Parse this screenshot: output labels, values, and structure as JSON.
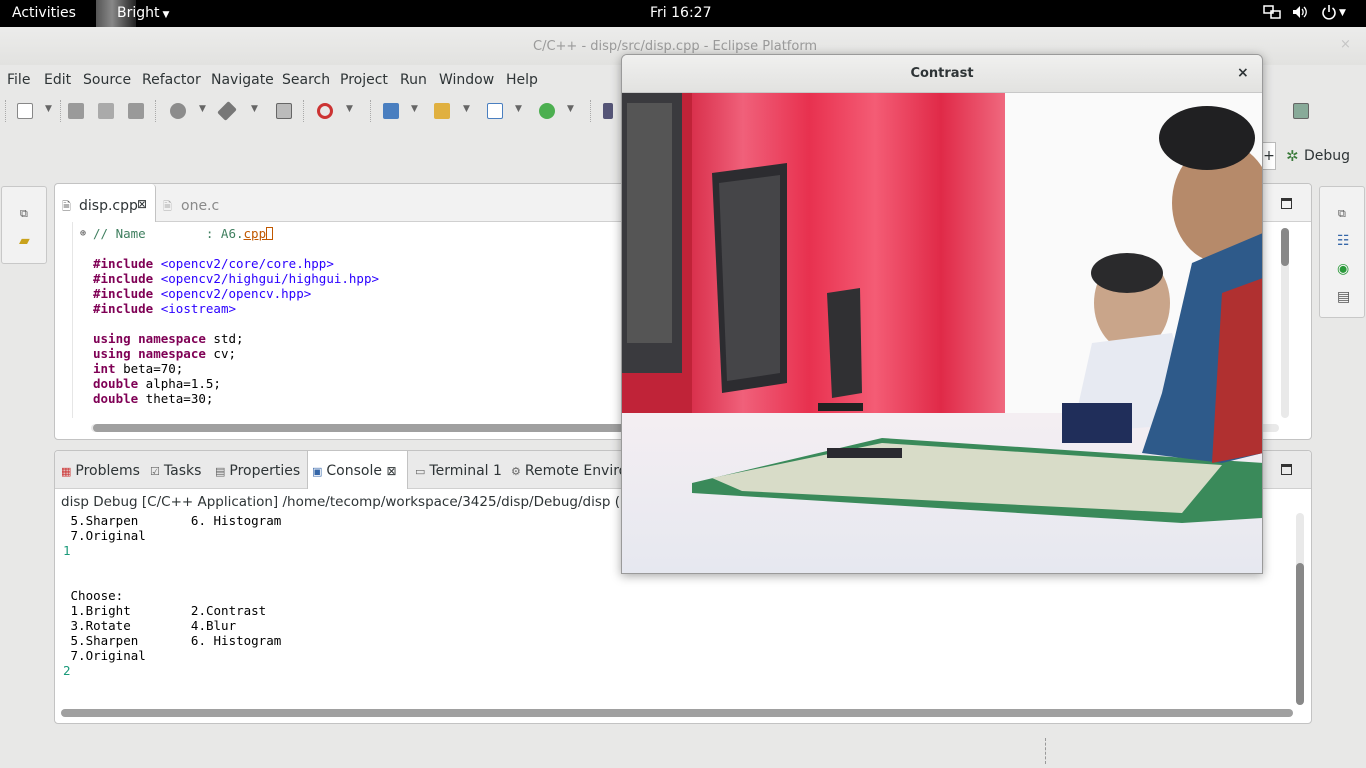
{
  "topbar": {
    "activities": "Activities",
    "app_name": "Bright",
    "clock": "Fri 16:27",
    "tray_icons": [
      "network-icon",
      "volume-icon",
      "power-icon"
    ]
  },
  "window": {
    "title": "C/C++ - disp/src/disp.cpp - Eclipse Platform",
    "close": "×"
  },
  "menubar": {
    "items": [
      "File",
      "Edit",
      "Source",
      "Refactor",
      "Navigate",
      "Search",
      "Project",
      "Run",
      "Window",
      "Help"
    ]
  },
  "perspective": {
    "plus": "+",
    "debug_label": "Debug"
  },
  "editor": {
    "tabs": [
      {
        "label": "disp.cpp",
        "close": "⊠"
      },
      {
        "label": "one.c"
      }
    ],
    "code": {
      "comment": "// Name        : A6.",
      "comment_cursor": "cpp",
      "inc_kw": "#include",
      "includes": [
        "<opencv2/core/core.hpp>",
        "<opencv2/highgui/highgui.hpp>",
        "<opencv2/opencv.hpp>",
        "<iostream>"
      ],
      "using_kw": "using namespace",
      "using_std": " std;",
      "using_cv": " cv;",
      "int_kw": "int",
      "int_rest": " beta=70;",
      "double_kw": "double",
      "double1_rest": " alpha=1.5;",
      "double2_rest": " theta=30;"
    }
  },
  "panel": {
    "tabs": [
      "Problems",
      "Tasks",
      "Properties",
      "Console",
      "Terminal 1",
      "Remote Enviro"
    ],
    "console_close": "⊠",
    "description": "disp Debug [C/C++ Application] /home/tecomp/workspace/3425/disp/Debug/disp (3/1",
    "lines": [
      {
        "text": " 5.Sharpen       6. Histogram",
        "input": false
      },
      {
        "text": " 7.Original",
        "input": false
      },
      {
        "text": "1",
        "input": true
      },
      {
        "text": "",
        "input": false
      },
      {
        "text": "",
        "input": false
      },
      {
        "text": " Choose:",
        "input": false
      },
      {
        "text": " 1.Bright        2.Contrast",
        "input": false
      },
      {
        "text": " 3.Rotate        4.Blur",
        "input": false
      },
      {
        "text": " 5.Sharpen       6. Histogram",
        "input": false
      },
      {
        "text": " 7.Original",
        "input": false
      },
      {
        "text": "2",
        "input": true
      }
    ]
  },
  "contrast_window": {
    "title": "Contrast",
    "close": "×",
    "image_description": "webcam frame: office with monitors, red curtain, two people at desk"
  }
}
